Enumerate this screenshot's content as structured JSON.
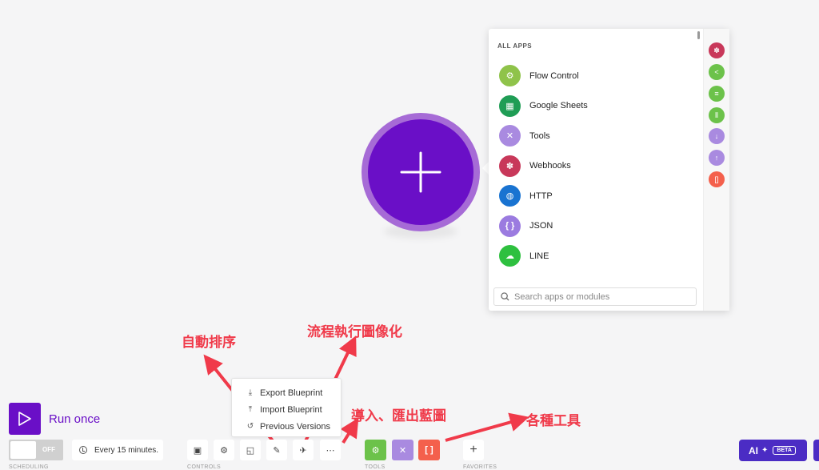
{
  "panel": {
    "header": "ALL APPS",
    "apps": [
      {
        "label": "Flow Control",
        "icon": "gear-icon",
        "color": "#8fc34a",
        "glyph": "⚙"
      },
      {
        "label": "Google Sheets",
        "icon": "sheets-icon",
        "color": "#1f9d55",
        "glyph": "▦"
      },
      {
        "label": "Tools",
        "icon": "tools-icon",
        "color": "#a98ae0",
        "glyph": "✕"
      },
      {
        "label": "Webhooks",
        "icon": "webhook-icon",
        "color": "#c8385a",
        "glyph": "✽"
      },
      {
        "label": "HTTP",
        "icon": "globe-icon",
        "color": "#1973d1",
        "glyph": "◍"
      },
      {
        "label": "JSON",
        "icon": "braces-icon",
        "color": "#9b7be0",
        "glyph": "{ }"
      },
      {
        "label": "LINE",
        "icon": "line-icon",
        "color": "#2ec03f",
        "glyph": "☁"
      }
    ],
    "search_placeholder": "Search apps or modules"
  },
  "rail": [
    {
      "icon": "webhook-icon",
      "color": "#c8385a",
      "glyph": "✽"
    },
    {
      "icon": "share-icon",
      "color": "#6cc24a",
      "glyph": "<"
    },
    {
      "icon": "list-add-icon",
      "color": "#6cc24a",
      "glyph": "≡"
    },
    {
      "icon": "columns-icon",
      "color": "#6cc24a",
      "glyph": "⫴"
    },
    {
      "icon": "download-icon",
      "color": "#a98ae0",
      "glyph": "↓"
    },
    {
      "icon": "upload-icon",
      "color": "#a98ae0",
      "glyph": "↑"
    },
    {
      "icon": "brackets-icon",
      "color": "#f4604c",
      "glyph": "[]"
    }
  ],
  "menu": {
    "items": [
      {
        "label": "Export Blueprint",
        "icon": "export-icon",
        "glyph": "⤓"
      },
      {
        "label": "Import Blueprint",
        "icon": "import-icon",
        "glyph": "⤒"
      },
      {
        "label": "Previous Versions",
        "icon": "history-icon",
        "glyph": "↺"
      }
    ]
  },
  "annotations": {
    "auto_align": "自動排序",
    "flow_visualize": "流程執行圖像化",
    "import_export": "導入、匯出藍圖",
    "tools": "各種工具"
  },
  "toolbar": {
    "run_label": "Run once",
    "toggle_state": "OFF",
    "schedule": "Every 15 minutes.",
    "sections": {
      "scheduling": "SCHEDULING",
      "controls": "CONTROLS",
      "tools": "TOOLS",
      "favorites": "FAVORITES"
    },
    "controls": [
      {
        "icon": "save-icon",
        "glyph": "▣"
      },
      {
        "icon": "gear-icon",
        "glyph": "⚙"
      },
      {
        "icon": "note-icon",
        "glyph": "◱"
      },
      {
        "icon": "magic-wand-icon",
        "glyph": "✎"
      },
      {
        "icon": "airplane-icon",
        "glyph": "✈"
      },
      {
        "icon": "more-icon",
        "glyph": "⋯"
      }
    ],
    "tools": [
      {
        "icon": "flow-control-icon",
        "color": "#6cc24a",
        "glyph": "⚙"
      },
      {
        "icon": "tools-icon",
        "color": "#a98ae0",
        "glyph": "✕"
      },
      {
        "icon": "text-parser-icon",
        "color": "#f4604c",
        "glyph": "[ ]"
      }
    ],
    "ai_label": "AI",
    "ai_badge": "BETA"
  }
}
